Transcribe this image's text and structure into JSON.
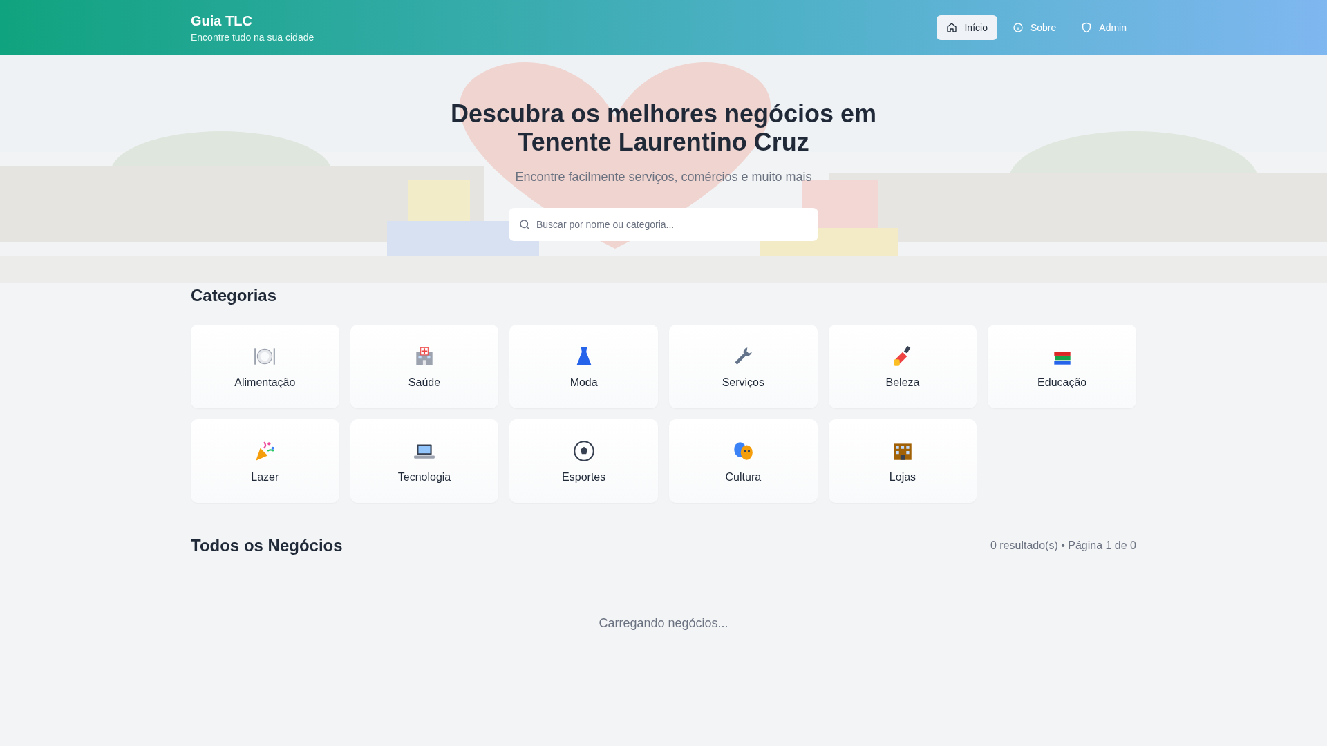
{
  "header": {
    "title": "Guia TLC",
    "subtitle": "Encontre tudo na sua cidade",
    "nav": [
      {
        "label": "Início",
        "selected": true
      },
      {
        "label": "Sobre",
        "selected": false
      },
      {
        "label": "Admin",
        "selected": false
      }
    ]
  },
  "hero": {
    "title": "Descubra os melhores negócios em Tenente Laurentino Cruz",
    "subtitle": "Encontre facilmente serviços, comércios e muito mais",
    "search": {
      "placeholder": "Buscar por nome ou categoria..."
    }
  },
  "categories": {
    "heading": "Categorias",
    "items": [
      {
        "label": "Alimentação"
      },
      {
        "label": "Saúde"
      },
      {
        "label": "Moda"
      },
      {
        "label": "Serviços"
      },
      {
        "label": "Beleza"
      },
      {
        "label": "Educação"
      },
      {
        "label": "Lazer"
      },
      {
        "label": "Tecnologia"
      },
      {
        "label": "Esportes"
      },
      {
        "label": "Cultura"
      },
      {
        "label": "Lojas"
      }
    ]
  },
  "businesses": {
    "heading": "Todos os Negócios",
    "summary": "0 resultado(s) • Página 1 de 0",
    "status": "Carregando negócios..."
  }
}
